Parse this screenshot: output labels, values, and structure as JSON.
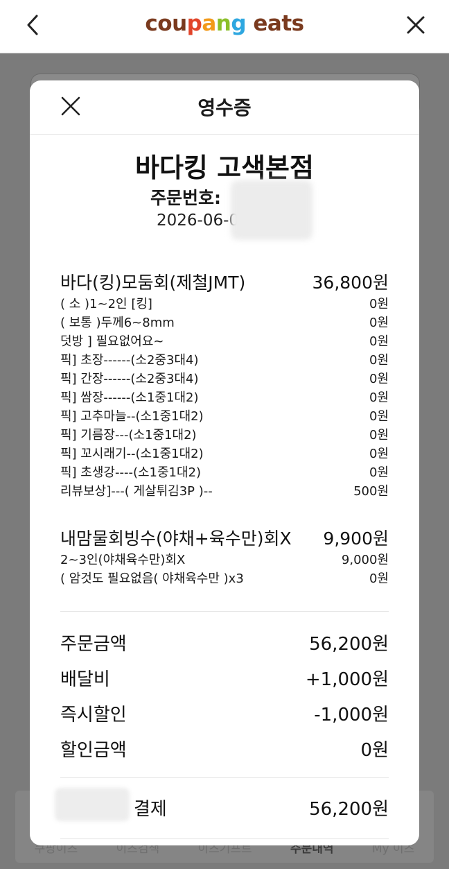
{
  "app": {
    "logo_parts": [
      {
        "text": "c",
        "color": "#7a3a1e"
      },
      {
        "text": "o",
        "color": "#7a3a1e"
      },
      {
        "text": "u",
        "color": "#7a3a1e"
      },
      {
        "text": "p",
        "color": "#e1442a"
      },
      {
        "text": "a",
        "color": "#f29a1a"
      },
      {
        "text": "n",
        "color": "#8bbf2a"
      },
      {
        "text": "g",
        "color": "#2ea7e0"
      },
      {
        "text": " eats",
        "color": "#7a3a1e"
      }
    ]
  },
  "background": {
    "tabs": [
      "쿠팡이츠",
      "이츠검색",
      "이츠기프트",
      "주문내역",
      "My 이츠"
    ]
  },
  "receipt": {
    "title": "영수증",
    "store": "바다킹 고색본점",
    "order_no_label": "주문번호:",
    "order_date": "2026-06-0",
    "items": [
      {
        "name": "바다(킹)모둠회(제철JMT)",
        "price": "36,800원",
        "options": [
          {
            "name": "( 소 )1~2인 [킹]",
            "price": "0원"
          },
          {
            "name": "( 보통 )두께6~8mm",
            "price": "0원"
          },
          {
            "name": "덧방 ] 필요없어요~",
            "price": "0원"
          },
          {
            "name": "픽] 초장------(소2중3대4)",
            "price": "0원"
          },
          {
            "name": "픽] 간장------(소2중3대4)",
            "price": "0원"
          },
          {
            "name": "픽] 쌈장------(소1중1대2)",
            "price": "0원"
          },
          {
            "name": "픽] 고추마늘--(소1중1대2)",
            "price": "0원"
          },
          {
            "name": "픽] 기름장---(소1중1대2)",
            "price": "0원"
          },
          {
            "name": "픽] 꼬시래기--(소1중1대2)",
            "price": "0원"
          },
          {
            "name": "픽] 초생강----(소1중1대2)",
            "price": "0원"
          },
          {
            "name": "리뷰보상]---( 게살튀김3P )--",
            "price": "500원"
          }
        ]
      },
      {
        "name": "내맘물회빙수(야채+육수만)회X",
        "price": "9,900원",
        "options": [
          {
            "name": "2~3인(야채육수만)회X",
            "price": "9,000원"
          },
          {
            "name": "( 암것도 필요없음( 야채육수만 )x3",
            "price": "0원"
          }
        ]
      }
    ],
    "summary": [
      {
        "label": "주문금액",
        "value": "56,200원"
      },
      {
        "label": "배달비",
        "value": "+1,000원"
      },
      {
        "label": "즉시할인",
        "value": "-1,000원"
      },
      {
        "label": "할인금액",
        "value": "0원"
      }
    ],
    "payment": {
      "label": "결제",
      "amount": "56,200원"
    }
  }
}
